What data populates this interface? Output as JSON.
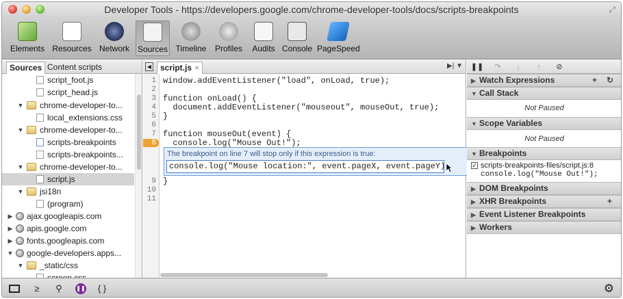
{
  "window": {
    "title": "Developer Tools - https://developers.google.com/chrome-developer-tools/docs/scripts-breakpoints"
  },
  "toolbar": {
    "items": [
      {
        "label": "Elements",
        "icon": "elements-icon"
      },
      {
        "label": "Resources",
        "icon": "resources-icon"
      },
      {
        "label": "Network",
        "icon": "network-icon"
      },
      {
        "label": "Sources",
        "icon": "sources-icon",
        "selected": true
      },
      {
        "label": "Timeline",
        "icon": "timeline-icon"
      },
      {
        "label": "Profiles",
        "icon": "profiles-icon"
      },
      {
        "label": "Audits",
        "icon": "audits-icon"
      },
      {
        "label": "Console",
        "icon": "console-icon"
      },
      {
        "label": "PageSpeed",
        "icon": "pagespeed-icon"
      }
    ]
  },
  "left_panel": {
    "tabs": [
      "Sources",
      "Content scripts"
    ],
    "tree": [
      {
        "label": "script_foot.js",
        "kind": "file"
      },
      {
        "label": "script_head.js",
        "kind": "file"
      },
      {
        "label": "chrome-developer-to...",
        "kind": "folder",
        "expanded": true
      },
      {
        "label": "local_extensions.css",
        "kind": "file"
      },
      {
        "label": "chrome-developer-to...",
        "kind": "folder",
        "expanded": true
      },
      {
        "label": "scripts-breakpoints",
        "kind": "js"
      },
      {
        "label": "scripts-breakpoints...",
        "kind": "file"
      },
      {
        "label": "chrome-developer-to...",
        "kind": "folder",
        "expanded": true
      },
      {
        "label": "script.js",
        "kind": "file",
        "selected": true
      },
      {
        "label": "jsi18n",
        "kind": "folder",
        "expanded": true
      },
      {
        "label": "(program)",
        "kind": "file"
      },
      {
        "label": "ajax.googleapis.com",
        "kind": "domain",
        "expanded": false
      },
      {
        "label": "apis.google.com",
        "kind": "domain",
        "expanded": false
      },
      {
        "label": "fonts.googleapis.com",
        "kind": "domain",
        "expanded": false
      },
      {
        "label": "google-developers.apps...",
        "kind": "domain",
        "expanded": true
      },
      {
        "label": "_static/css",
        "kind": "folder",
        "expanded": true
      },
      {
        "label": "screen.css",
        "kind": "file"
      }
    ]
  },
  "editor": {
    "tab_label": "script.js",
    "tab_close": "×",
    "lines": [
      {
        "n": "1",
        "code": "window.addEventListener(\"load\", onLoad, true);"
      },
      {
        "n": "2",
        "code": ""
      },
      {
        "n": "3",
        "code": "function onLoad() {"
      },
      {
        "n": "4",
        "code": "  document.addEventListener(\"mouseout\", mouseOut, true);"
      },
      {
        "n": "5",
        "code": "}"
      },
      {
        "n": "6",
        "code": ""
      },
      {
        "n": "7",
        "code": "function mouseOut(event) {"
      },
      {
        "n": "8",
        "code": "  console.log(\"Mouse Out!\");"
      },
      {
        "n": "9",
        "code": "}"
      },
      {
        "n": "10",
        "code": ""
      },
      {
        "n": "11",
        "code": ""
      }
    ],
    "breakpoint_line": "8",
    "condition": {
      "label": "The breakpoint on line 7 will stop only if this expression is true:",
      "value": "console.log(\"Mouse location:\", event.pageX, event.pageY)"
    }
  },
  "debugger": {
    "sections": [
      {
        "title": "Watch Expressions",
        "expanded": false,
        "actions": [
          "+",
          "↻"
        ]
      },
      {
        "title": "Call Stack",
        "expanded": true,
        "content": "Not Paused"
      },
      {
        "title": "Scope Variables",
        "expanded": true,
        "content": "Not Paused"
      },
      {
        "title": "Breakpoints",
        "expanded": true
      },
      {
        "title": "DOM Breakpoints",
        "expanded": false
      },
      {
        "title": "XHR Breakpoints",
        "expanded": false,
        "actions": [
          "+"
        ]
      },
      {
        "title": "Event Listener Breakpoints",
        "expanded": false
      },
      {
        "title": "Workers",
        "expanded": false
      }
    ],
    "breakpoint_entry": {
      "file": "scripts-breakpoints-files/script.js:8",
      "code": "console.log(\"Mouse Out!\");",
      "checked": true
    }
  },
  "status_bar": {
    "icons": [
      "dock-icon",
      "console-drawer-icon",
      "search-icon",
      "pause-on-exceptions-icon",
      "pretty-print-icon",
      "settings-gear-icon"
    ],
    "console_glyph": "≥",
    "search_glyph": "⚲",
    "pretty_print_glyph": "{ }",
    "gear_glyph": "⚙"
  }
}
